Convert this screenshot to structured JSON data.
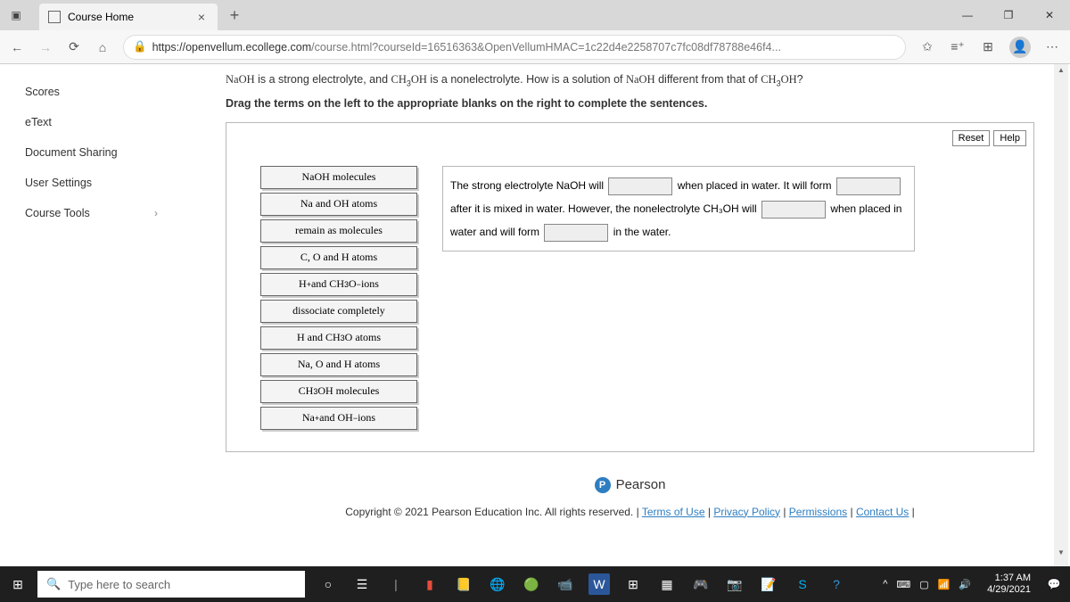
{
  "browser": {
    "tab_title": "Course Home",
    "close_glyph": "×",
    "newtab_glyph": "+",
    "win_min": "—",
    "win_max": "❐",
    "win_close": "✕",
    "back": "←",
    "forward": "→",
    "refresh": "⟳",
    "home": "⌂",
    "lock": "🔒",
    "url_host": "https://openvellum.ecollege.com",
    "url_path": "/course.html?courseId=16516363&OpenVellumHMAC=1c22d4e2258707c7fc08df78788e46f4...",
    "star": "✩",
    "fav": "≡⁺",
    "collections": "⊞",
    "avatar": "👤",
    "more": "⋯"
  },
  "sidebar": {
    "items": [
      "Scores",
      "eText",
      "Document Sharing",
      "User Settings",
      "Course Tools"
    ],
    "chevron": "›"
  },
  "question": {
    "text_html": "NaOH is a strong electrolyte, and CH₃OH is a nonelectrolyte. How is a solution of NaOH different from that of CH₃OH?",
    "instruction": "Drag the terms on the left to the appropriate blanks on the right to complete the sentences.",
    "reset": "Reset",
    "help": "Help",
    "terms": [
      "NaOH molecules",
      "Na and OH atoms",
      "remain as molecules",
      "C, O and H atoms",
      "H⁺ and CH₃O⁻ ions",
      "dissociate completely",
      "H and CH₃O atoms",
      "Na, O and H atoms",
      "CH₃OH molecules",
      "Na⁺ and OH⁻ ions"
    ],
    "sentence": {
      "p1": "The strong electrolyte NaOH will ",
      "p2": " when placed in water. It will form ",
      "p3": " after it is mixed in water. However, the nonelectrolyte CH₃OH will ",
      "p4": " when placed in water and will form ",
      "p5": " in the water."
    }
  },
  "pearson": {
    "label": "Pearson",
    "p": "P"
  },
  "footer": {
    "copyright": "Copyright © 2021 Pearson Education Inc. All rights reserved. | ",
    "terms": "Terms of Use",
    "privacy": "Privacy Policy",
    "permissions": "Permissions",
    "contact": "Contact Us",
    "sep": " | "
  },
  "taskbar": {
    "start": "⊞",
    "search_icon": "🔍",
    "search_placeholder": "Type here to search",
    "icons": [
      "○",
      "☰",
      "▮",
      "📒",
      "🌐",
      "🟢",
      "📹",
      "W",
      "⊞",
      "▦",
      "🎮",
      "📷",
      "📝",
      "S",
      "?"
    ],
    "tray": [
      "^",
      "⌨",
      "▢",
      "📶",
      "🔊"
    ],
    "time": "1:37 AM",
    "date": "4/29/2021",
    "notif": "💬"
  }
}
